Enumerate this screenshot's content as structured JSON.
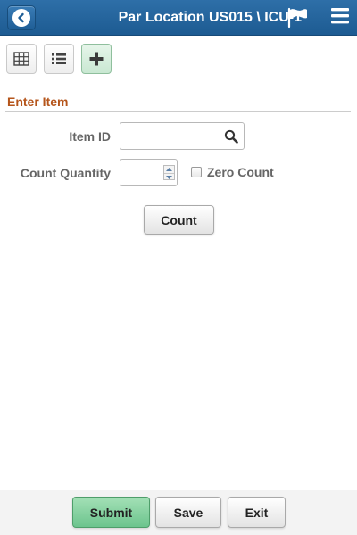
{
  "header": {
    "title": "Par Location US015 \\ ICU-1",
    "back_icon": "back-arrow-icon",
    "flag_icon": "flag-icon",
    "menu_icon": "hamburger-menu-icon",
    "bar_color": "#1d5b92"
  },
  "toolbar": {
    "buttons": [
      {
        "icon": "grid-view-icon",
        "active": false
      },
      {
        "icon": "list-view-icon",
        "active": false
      },
      {
        "icon": "add-icon",
        "active": true
      }
    ]
  },
  "section": {
    "title": "Enter Item",
    "title_color": "#b5551b"
  },
  "form": {
    "item_id_label": "Item ID",
    "item_id_value": "",
    "count_quantity_label": "Count Quantity",
    "count_quantity_value": "",
    "zero_count_label": "Zero Count",
    "zero_count_checked": false,
    "count_button": "Count"
  },
  "footer": {
    "submit": "Submit",
    "save": "Save",
    "exit": "Exit",
    "submit_color": "#6cc48d"
  }
}
